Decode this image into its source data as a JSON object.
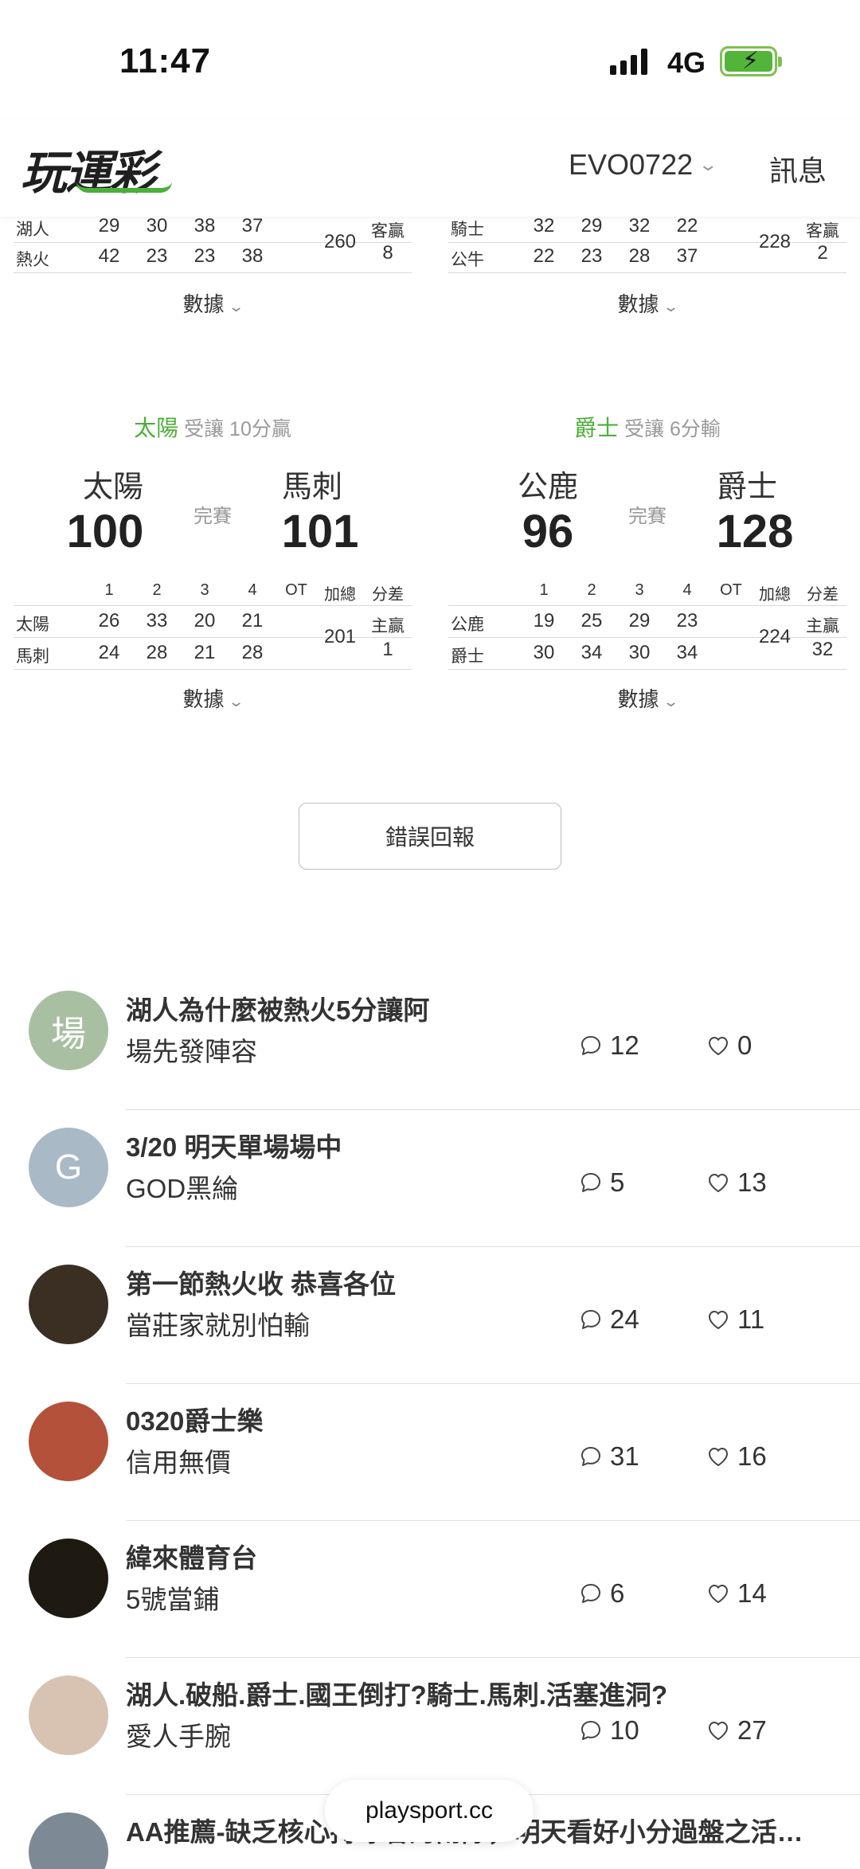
{
  "status_bar": {
    "time": "11:47",
    "network": "4G"
  },
  "header": {
    "logo_text": "玩運彩",
    "username": "EVO0722",
    "messages_label": "訊息"
  },
  "top_cards": [
    {
      "rows": [
        {
          "team": "湖人",
          "q": [
            "29",
            "30",
            "38",
            "37"
          ]
        },
        {
          "team": "熱火",
          "q": [
            "42",
            "23",
            "23",
            "38"
          ]
        }
      ],
      "total": "260",
      "result_label": "客贏",
      "result_diff": "8",
      "stats_label": "數據"
    },
    {
      "rows": [
        {
          "team": "騎士",
          "q": [
            "32",
            "29",
            "32",
            "22"
          ]
        },
        {
          "team": "公牛",
          "q": [
            "22",
            "23",
            "28",
            "37"
          ]
        }
      ],
      "total": "228",
      "result_label": "客贏",
      "result_diff": "2",
      "stats_label": "數據"
    }
  ],
  "cards": [
    {
      "spread_team": "太陽",
      "spread_text": "受讓 10分贏",
      "away": "太陽",
      "home": "馬刺",
      "away_score": "100",
      "home_score": "101",
      "status": "完賽",
      "headers": [
        "1",
        "2",
        "3",
        "4",
        "OT",
        "加總",
        "分差"
      ],
      "rows": [
        {
          "team": "太陽",
          "q": [
            "26",
            "33",
            "20",
            "21"
          ]
        },
        {
          "team": "馬刺",
          "q": [
            "24",
            "28",
            "21",
            "28"
          ]
        }
      ],
      "total": "201",
      "result_label": "主贏",
      "result_diff": "1",
      "stats_label": "數據"
    },
    {
      "spread_team": "爵士",
      "spread_text": "受讓 6分輸",
      "away": "公鹿",
      "home": "爵士",
      "away_score": "96",
      "home_score": "128",
      "status": "完賽",
      "headers": [
        "1",
        "2",
        "3",
        "4",
        "OT",
        "加總",
        "分差"
      ],
      "rows": [
        {
          "team": "公鹿",
          "q": [
            "19",
            "25",
            "29",
            "23"
          ]
        },
        {
          "team": "爵士",
          "q": [
            "30",
            "34",
            "30",
            "34"
          ]
        }
      ],
      "total": "224",
      "result_label": "主贏",
      "result_diff": "32",
      "stats_label": "數據"
    }
  ],
  "report_button": "錯誤回報",
  "posts": [
    {
      "avatar_text": "場",
      "avatar_color": "#a9bfa2",
      "title": "湖人為什麼被熱火5分讓阿",
      "author": "場先發陣容",
      "comments": "12",
      "likes": "0"
    },
    {
      "avatar_text": "G",
      "avatar_color": "#a9b9c6",
      "title": "3/20 明天單場場中",
      "author": "GOD黑綸",
      "comments": "5",
      "likes": "13"
    },
    {
      "avatar_text": "",
      "avatar_color": "#3a2f22",
      "title": "第一節熱火收 恭喜各位",
      "author": "當莊家就別怕輸",
      "comments": "24",
      "likes": "11"
    },
    {
      "avatar_text": "",
      "avatar_color": "#b4513a",
      "title": "0320爵士樂",
      "author": "信用無價",
      "comments": "31",
      "likes": "16"
    },
    {
      "avatar_text": "",
      "avatar_color": "#1e1a12",
      "title": "緯來體育台",
      "author": "5號當鋪",
      "comments": "6",
      "likes": "14"
    },
    {
      "avatar_text": "",
      "avatar_color": "#d8c2b2",
      "title": "湖人.破船.爵士.國王倒打?騎士.馬刺.活塞進洞?",
      "author": "愛人手腕",
      "comments": "10",
      "likes": "27"
    },
    {
      "avatar_text": "",
      "avatar_color": "#7d8a96",
      "title": "AA推薦-缺乏核心持球者的兩隊，明天看好小分過盤之活…",
      "author": "",
      "comments": "",
      "likes": ""
    }
  ],
  "url_bar": "playsport.cc",
  "colors": {
    "accent_green": "#4caf3a",
    "muted": "#999999"
  }
}
